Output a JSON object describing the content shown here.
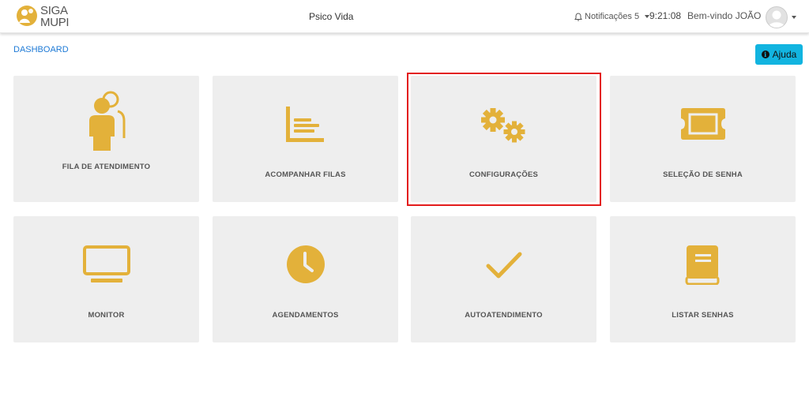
{
  "header": {
    "logo_line1": "SIGA",
    "logo_line2": "MUPI",
    "app_name": "Psico Vida",
    "notifications_label": "Notificações 5",
    "time": "9:21:08",
    "welcome": "Bem-vindo JOÃO"
  },
  "breadcrumb": "DASHBOARD",
  "help_button": "Ajuda",
  "cards": [
    {
      "label": "FILA DE ATENDIMENTO",
      "icon": "queue-person-icon"
    },
    {
      "label": "ACOMPANHAR FILAS",
      "icon": "list-chart-icon"
    },
    {
      "label": "CONFIGURAÇÕES",
      "icon": "gears-icon"
    },
    {
      "label": "SELEÇÃO DE SENHA",
      "icon": "ticket-icon"
    },
    {
      "label": "MONITOR",
      "icon": "monitor-icon"
    },
    {
      "label": "AGENDAMENTOS",
      "icon": "clock-icon"
    },
    {
      "label": "AUTOATENDIMENTO",
      "icon": "check-icon"
    },
    {
      "label": "LISTAR SENHAS",
      "icon": "book-icon"
    }
  ],
  "colors": {
    "icon": "#e3b13a",
    "card_bg": "#eeeeee",
    "link": "#1e7ad6",
    "help_button": "#12b4e0",
    "highlight": "#e31b1b"
  }
}
